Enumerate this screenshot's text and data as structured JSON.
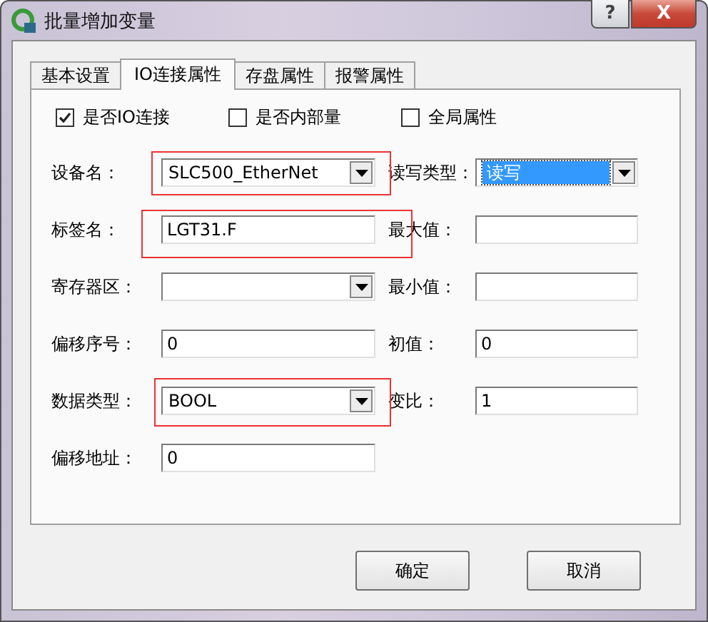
{
  "window": {
    "title": "批量增加变量",
    "buttons": [
      {
        "kind": "help",
        "label": "?"
      },
      {
        "kind": "close",
        "label": "X"
      }
    ]
  },
  "tabs": [
    {
      "label": "基本设置",
      "selected": false
    },
    {
      "label": "IO连接属性",
      "selected": true
    },
    {
      "label": "存盘属性",
      "selected": false
    },
    {
      "label": "报警属性",
      "selected": false
    }
  ],
  "checkboxes": [
    {
      "label": "是否IO连接",
      "checked": true
    },
    {
      "label": "是否内部量",
      "checked": false
    },
    {
      "label": "全局属性",
      "checked": false
    }
  ],
  "rows": [
    [
      {
        "label": "设备名：",
        "kind": "dropdown",
        "value": "SLC500_EtherNet",
        "highlighted": true
      },
      {
        "label": "读写类型：",
        "kind": "dropdown",
        "value": "读写",
        "focused": true
      }
    ],
    [
      {
        "label": "标签名：",
        "kind": "text",
        "value": "LGT31.F",
        "highlighted": true
      },
      {
        "label": "最大值：",
        "kind": "text"
      }
    ],
    [
      {
        "label": "寄存器区：",
        "kind": "dropdown"
      },
      {
        "label": "最小值：",
        "kind": "text"
      }
    ],
    [
      {
        "label": "偏移序号：",
        "kind": "text",
        "value": "0"
      },
      {
        "label": "初值：",
        "kind": "text",
        "value": "0"
      }
    ],
    [
      {
        "label": "数据类型：",
        "kind": "dropdown",
        "value": "BOOL",
        "highlighted": true
      },
      {
        "label": "变比：",
        "kind": "text",
        "value": "1"
      }
    ],
    [
      {
        "label": "偏移地址：",
        "kind": "text",
        "value": "0"
      }
    ]
  ],
  "buttons": [
    {
      "label": "确定"
    },
    {
      "label": "取消"
    }
  ]
}
